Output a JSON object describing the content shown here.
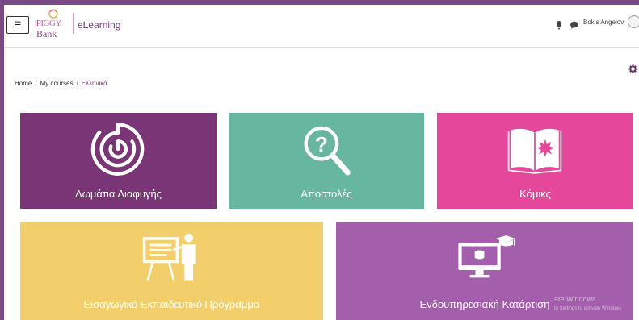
{
  "header": {
    "logo_text": "PIGGY Bank",
    "app_name": "eLearning",
    "user_name": "Bokis Angelov"
  },
  "breadcrumb": [
    "Home",
    "My courses",
    "Ελληνικά"
  ],
  "tiles": [
    {
      "label": "Δωμάτια Διαφυγής",
      "color": "#7a3576",
      "icon": "maze-icon"
    },
    {
      "label": "Αποστολές",
      "color": "#67b6a0",
      "icon": "question-magnifier-icon"
    },
    {
      "label": "Κόμικς",
      "color": "#e5489a",
      "icon": "open-book-icon"
    },
    {
      "label": "Εισαγωγικό Εκπαιδευτικό Πρόγραμμα",
      "color": "#f3cf6c",
      "icon": "presenter-icon"
    },
    {
      "label": "Ενδοϋπηρεσιακή Κατάρτιση",
      "color": "#a45fac",
      "icon": "monitor-graduation-icon"
    }
  ],
  "watermark": {
    "line1": "ate Windows",
    "line2": "to Settings to activate Windows"
  },
  "colors": {
    "accent": "#7a3d7f",
    "window_border": "#7a4a86"
  }
}
